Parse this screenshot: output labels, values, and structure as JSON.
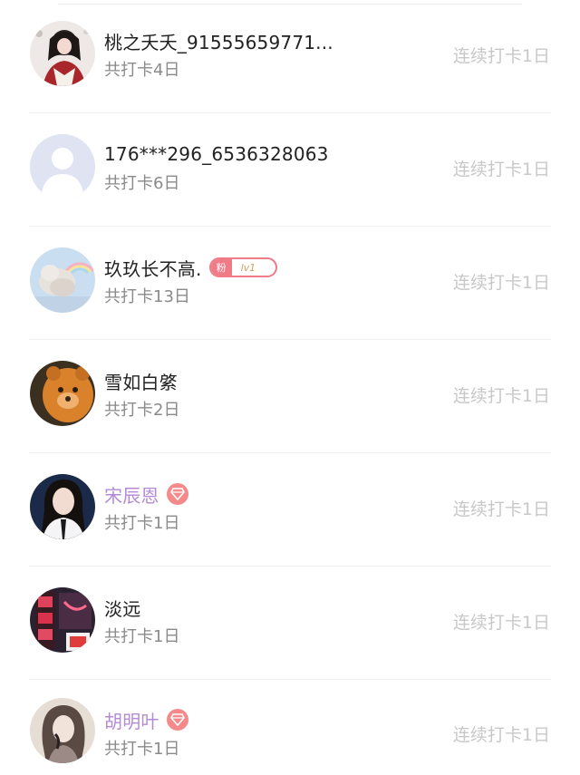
{
  "rows": [
    {
      "name": "桃之夭夭_91555659771...",
      "total": "共打卡4日",
      "streak": "连续打卡1日",
      "avatar": "avatar-illustrated-girl"
    },
    {
      "name": "176***296_6536328063",
      "total": "共打卡6日",
      "streak": "连续打卡1日",
      "avatar": "avatar-default-silhouette"
    },
    {
      "name": "玖玖长不高.",
      "total": "共打卡13日",
      "streak": "连续打卡1日",
      "avatar": "avatar-cloud-rainbow",
      "badge": {
        "label": "粉",
        "level": "lv1"
      }
    },
    {
      "name": "雪如白綮",
      "total": "共打卡2日",
      "streak": "连续打卡1日",
      "avatar": "avatar-orange-bear"
    },
    {
      "name": "宋辰恩",
      "total": "共打卡1日",
      "streak": "连续打卡1日",
      "avatar": "avatar-portrait-woman",
      "vip_icon": "diamond-icon"
    },
    {
      "name": "淡远",
      "total": "共打卡1日",
      "streak": "连续打卡1日",
      "avatar": "avatar-neon-sign"
    },
    {
      "name": "胡明叶",
      "total": "共打卡1日",
      "streak": "连续打卡1日",
      "avatar": "avatar-sketch-girl",
      "vip_icon": "diamond-icon"
    }
  ],
  "colors": {
    "vip_name": "#b48ad6",
    "badge": "#f07a86",
    "streak_text": "#c8c8c8",
    "sub_text": "#8a8a8a"
  }
}
